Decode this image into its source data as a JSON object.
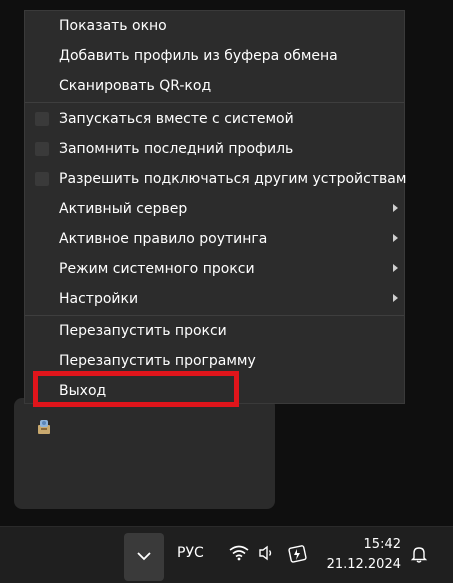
{
  "menu": {
    "items": [
      {
        "label": "Показать окно"
      },
      {
        "label": "Добавить профиль из буфера обмена"
      },
      {
        "label": "Сканировать QR-код"
      },
      {
        "label": "Запускаться вместе с системой"
      },
      {
        "label": "Запомнить последний профиль"
      },
      {
        "label": "Разрешить подключаться другим устройствам"
      },
      {
        "label": "Активный сервер"
      },
      {
        "label": "Активное правило роутинга"
      },
      {
        "label": "Режим системного прокси"
      },
      {
        "label": "Настройки"
      },
      {
        "label": "Перезапустить прокси"
      },
      {
        "label": "Перезапустить программу"
      },
      {
        "label": "Выход"
      }
    ]
  },
  "annotation": {
    "color": "#e0151b"
  },
  "taskbar": {
    "language": "РУС",
    "time": "15:42",
    "date": "21.12.2024"
  }
}
